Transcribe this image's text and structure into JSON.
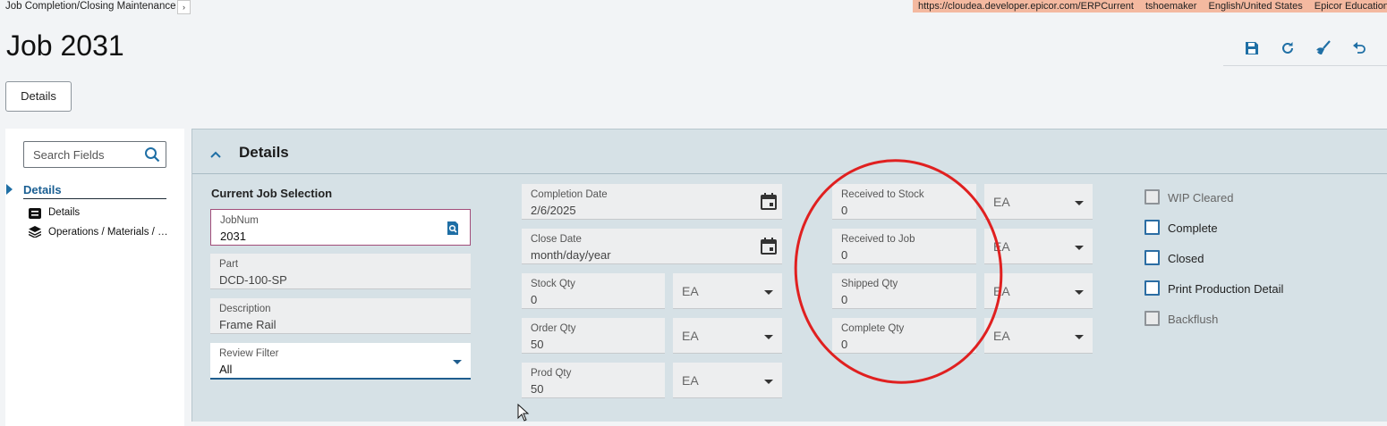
{
  "breadcrumb": {
    "label": "Job Completion/Closing Maintenance",
    "chevron": "›"
  },
  "env": {
    "url": "https://cloudea.developer.epicor.com/ERPCurrent",
    "user": "tshoemaker",
    "locale": "English/United States",
    "company": "Epicor Education"
  },
  "page_title": "Job 2031",
  "toolbar": {
    "icons": [
      "save-icon",
      "refresh-icon",
      "clear-icon",
      "undo-icon"
    ],
    "accent": "#1f6fa5"
  },
  "details_button": "Details",
  "nav": {
    "search_placeholder": "Search Fields",
    "header": "Details",
    "items": [
      {
        "label": "Details",
        "icon": "list-icon"
      },
      {
        "label": "Operations / Materials / …",
        "icon": "layers-icon"
      }
    ]
  },
  "panel": {
    "title": "Details",
    "section": "Current Job Selection",
    "jobnum": {
      "label": "JobNum",
      "value": "2031"
    },
    "part": {
      "label": "Part",
      "value": "DCD-100-SP"
    },
    "description": {
      "label": "Description",
      "value": "Frame Rail"
    },
    "review_filter": {
      "label": "Review Filter",
      "value": "All"
    },
    "completion_date": {
      "label": "Completion Date",
      "value": "2/6/2025"
    },
    "close_date": {
      "label": "Close Date",
      "value": "month/day/year"
    },
    "stock_qty": {
      "label": "Stock Qty",
      "value": "0",
      "uom": "EA"
    },
    "order_qty": {
      "label": "Order Qty",
      "value": "50",
      "uom": "EA"
    },
    "prod_qty": {
      "label": "Prod Qty",
      "value": "50",
      "uom": "EA"
    },
    "received_to_stock": {
      "label": "Received to Stock",
      "value": "0",
      "uom": "EA"
    },
    "received_to_job": {
      "label": "Received to Job",
      "value": "0",
      "uom": "EA"
    },
    "shipped_qty": {
      "label": "Shipped Qty",
      "value": "0",
      "uom": "EA"
    },
    "complete_qty": {
      "label": "Complete Qty",
      "value": "0",
      "uom": "EA"
    },
    "checkboxes": [
      {
        "label": "WIP Cleared",
        "checked": false,
        "disabled": true
      },
      {
        "label": "Complete",
        "checked": false,
        "disabled": false
      },
      {
        "label": "Closed",
        "checked": false,
        "disabled": false
      },
      {
        "label": "Print Production Detail",
        "checked": false,
        "disabled": false
      },
      {
        "label": "Backflush",
        "checked": false,
        "disabled": true
      }
    ]
  },
  "colors": {
    "highlight_circle": "#e02020",
    "env_banner": "#f4b9a0",
    "panel_bg": "#d6e1e6"
  }
}
